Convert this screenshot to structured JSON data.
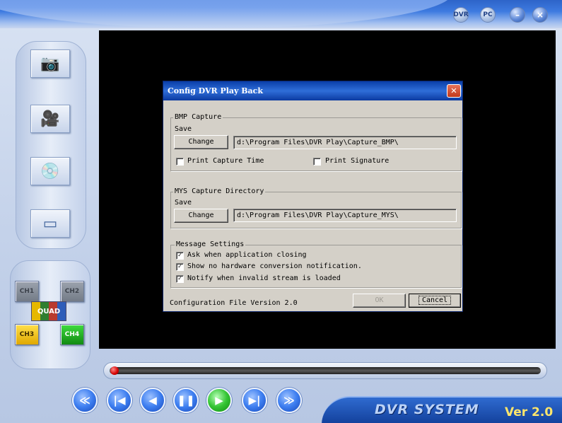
{
  "header": {
    "buttons": [
      {
        "label": "DVR",
        "icon": "dvr-icon"
      },
      {
        "label": "PC",
        "icon": "pc-icon"
      },
      {
        "label": "–",
        "icon": "minimize-icon"
      },
      {
        "label": "×",
        "icon": "close-icon"
      }
    ]
  },
  "sidebar": {
    "tools": [
      {
        "icon": "camera-icon",
        "glyph": "📷"
      },
      {
        "icon": "video-camera-icon",
        "glyph": "🎥"
      },
      {
        "icon": "disk-icon",
        "glyph": "💿"
      },
      {
        "icon": "screen-icon",
        "glyph": "▭"
      }
    ],
    "channels": {
      "ch1": "CH1",
      "ch2": "CH2",
      "quad": "QUAD",
      "ch3": "CH3",
      "ch4": "CH4"
    }
  },
  "dialog": {
    "title": "Config DVR Play Back",
    "close_glyph": "✕",
    "bmp_group": {
      "label": "BMP Capture",
      "save_label": "Save",
      "change_button": "Change",
      "path": "d:\\Program Files\\DVR Play\\Capture_BMP\\",
      "print_capture_time": {
        "label": "Print Capture Time",
        "checked": false
      },
      "print_signature": {
        "label": "Print Signature",
        "checked": false
      }
    },
    "mys_group": {
      "label": "MYS Capture Directory",
      "save_label": "Save",
      "change_button": "Change",
      "path": "d:\\Program Files\\DVR Play\\Capture_MYS\\"
    },
    "message_group": {
      "label": "Message Settings",
      "options": [
        {
          "label": "Ask when application closing",
          "checked": true
        },
        {
          "label": "Show no hardware conversion notification.",
          "checked": true
        },
        {
          "label": "Notify when invalid stream is loaded",
          "checked": true
        }
      ]
    },
    "version_text": "Configuration File Version 2.0",
    "ok_button": "OK",
    "cancel_button": "Cancel"
  },
  "playback": {
    "controls": [
      {
        "icon": "fast-rewind-icon",
        "glyph": "≪"
      },
      {
        "icon": "skip-back-icon",
        "glyph": "|◀"
      },
      {
        "icon": "step-back-icon",
        "glyph": "◀"
      },
      {
        "icon": "pause-icon",
        "glyph": "❚❚"
      },
      {
        "icon": "play-icon",
        "glyph": "▶"
      },
      {
        "icon": "skip-forward-icon",
        "glyph": "▶|"
      },
      {
        "icon": "fast-forward-icon",
        "glyph": "≫"
      }
    ],
    "progress": 0
  },
  "brand": {
    "name": "DVR SYSTEM",
    "version": "Ver 2.0"
  },
  "colors": {
    "accent": "#2f6bd0",
    "titlebar": "#0a3ea8",
    "dialog_bg": "#d4d0c8",
    "video_bg": "#000000"
  }
}
